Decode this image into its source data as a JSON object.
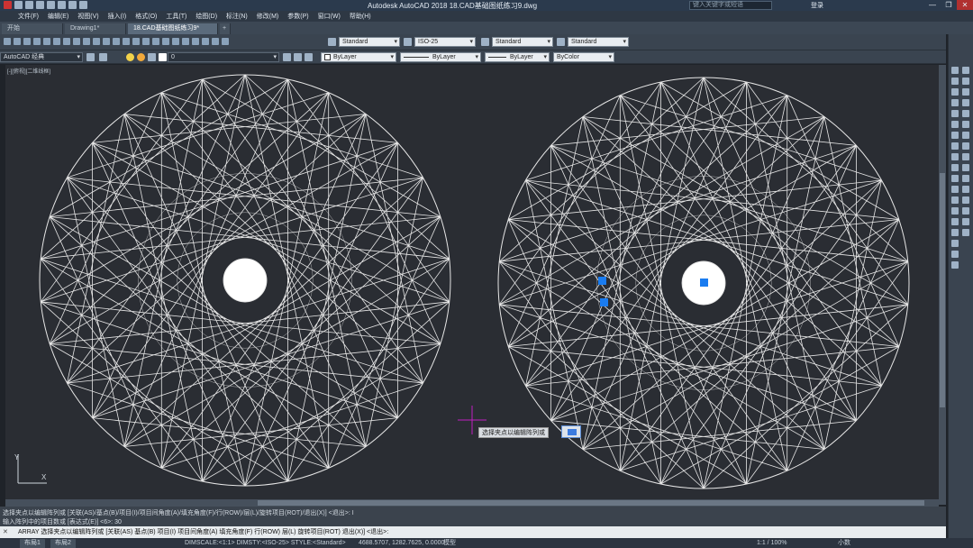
{
  "app": {
    "title": "Autodesk AutoCAD 2018    18.CAD基础图纸练习9.dwg",
    "search_placeholder": "键入关键字或短语",
    "login_label": "登录",
    "workspace": "AutoCAD 经典"
  },
  "menu": [
    "文件(F)",
    "编辑(E)",
    "视图(V)",
    "插入(I)",
    "格式(O)",
    "工具(T)",
    "绘图(D)",
    "标注(N)",
    "修改(M)",
    "参数(P)",
    "窗口(W)",
    "帮助(H)"
  ],
  "tabs": [
    {
      "label": "开始"
    },
    {
      "label": "Drawing1*"
    },
    {
      "label": "18.CAD基础图纸练习9*"
    }
  ],
  "styles": {
    "text_style": "Standard",
    "dim_style": "ISO-25",
    "table_style": "Standard",
    "multileader_style": "Standard"
  },
  "layers": {
    "workspace_combo": "AutoCAD 经典",
    "layer": "0",
    "color": "ByLayer",
    "linetype": "ByLayer",
    "lineweight": "ByLayer",
    "plotstyle": "ByColor"
  },
  "viewport_label": "[-][俯视][二维线框]",
  "tooltip": "选择夹点以编辑阵列或",
  "command_history": [
    "选择夹点以编辑阵列或 [关联(AS)/基点(B)/项目(I)/项目间角度(A)/填充角度(F)/行(ROW)/层(L)/旋转项目(ROT)/退出(X)] <退出>: I",
    "输入阵列中的项目数或 [表达式(E)] <6>: 30"
  ],
  "command_line": "ARRAY 选择夹点以编辑阵列或 [关联(AS) 基点(B) 项目(I) 项目间角度(A) 填充角度(F) 行(ROW) 层(L) 旋转项目(ROT) 退出(X)] <退出>:",
  "status": {
    "layout_tabs": [
      "布局1",
      "布局2"
    ],
    "info": "DIMSCALE:<1:1> DIMSTY:<ISO-25> STYLE:<Standard>",
    "coords": "4688.5707, 1282.7625, 0.0000",
    "mode": "模型",
    "scale": "1:1 / 100%",
    "units": "小数"
  },
  "colors": {
    "canvas": "#2a2d33",
    "grip": "#1a7cf0",
    "crosshair": "#c020c0",
    "linework": "#e6e6e6"
  },
  "drawings": [
    {
      "type": "polar-array-string-art",
      "items": 30
    },
    {
      "type": "polar-array-string-art",
      "items": 30
    }
  ]
}
